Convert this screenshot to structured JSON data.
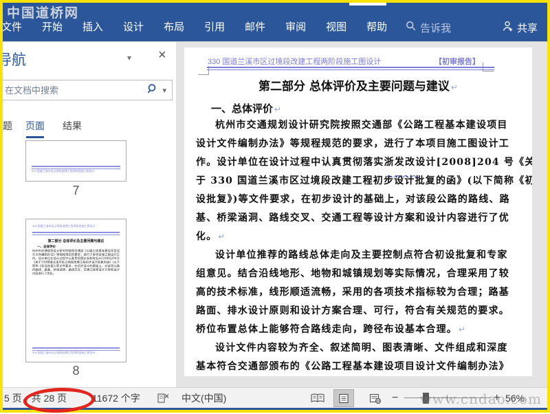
{
  "watermarks": {
    "top_left": "中国道桥网",
    "bottom_right": "www.cndao.com"
  },
  "ribbon": {
    "tabs": [
      "文件",
      "开始",
      "插入",
      "设计",
      "布局",
      "引用",
      "邮件",
      "审阅",
      "视图",
      "帮助"
    ],
    "tell_me": "告诉我",
    "share": "共享"
  },
  "navigation": {
    "title": "导航",
    "search_placeholder": "在文档中搜索",
    "tabs": [
      "标题",
      "页面",
      "结果"
    ],
    "active_tab": "页面",
    "thumbnails": [
      {
        "page": "7",
        "footer_text": "330 国道兰溪市区过境段改建工程两阶段施工图设计"
      },
      {
        "page": "8",
        "header_text": "330 国道兰溪市区过境段改建工程两阶段施工图设计",
        "preview_title": "第二部分 总体评价及主要问题与建议",
        "preview_heading": "一、总体评价",
        "preview_text": "杭州市交通规划设计研究院按照交通部《公路工程基本建设项目设计文件编制办法》等规程规范的要求，进行了本项目施工图设计工作。设计单位在设计过程中认真贯彻落实浙发改设计[2008]204号《关于330国道兰溪市区过境段改建工程初步设计批复的函》(以下简称《初设批复》)等文件要求，在初步设计的基础上，对该段公路的路线、路基、桥梁涵洞、路线交叉、交通工程等设计方案和设计内容进行了优化。",
        "footer_text": "330 国道兰溪市区过境段改建工程两阶段施工图设计"
      }
    ]
  },
  "document": {
    "header_left": "330 国道兰溪市区过境段改建工程两阶段施工图设计",
    "header_right": "【初审报告】",
    "title": "第二部分  总体评价及主要问题与建议",
    "heading": "一、总体评价",
    "paragraph_mark": "↵",
    "p1": [
      "杭州市交通规划设计研究院按照交通部《公路工程基本建设项目",
      "设计文件编制办法》等规程规范的要求，进行了本项目施工图设计工",
      "作。设计单位在设计过程中认真贯彻落实浙发改设计[2008]204 号《关",
      "于 330 国道兰溪市区过境段改建工程初步设计批复的函》(以下简称《初",
      "设批复》)等文件要求，在初步设计的基础上，对该段公路的路线、路",
      "基、桥梁涵洞、路线交叉、交通工程等设计方案和设计内容进行了优",
      "化。"
    ],
    "p2": [
      "设计单位推荐的路线总体走向及主要控制点符合初设批复和专家",
      "组意见。结合沿线地形、地物和城镇规划等实际情况，合理采用了较",
      "高的技术标准，线形顺适流畅，采用的各项技术指标较为合理；路基",
      "路面、排水设计原则和设计方案合理、可行，符合有关规范的要求。",
      "桥位布置总体上能够符合路线走向，跨径布设基本合理。"
    ],
    "p3": [
      "设计文件内容较为齐全、叙述简明、图表清晰、文件组成和深度",
      "基本符合交通部颁布的《公路工程基本建设项目设计文件编制办法》"
    ]
  },
  "status_bar": {
    "page_info": "5 页，共 28 页",
    "word_count": "11672 个字",
    "language": "中文(中国)",
    "zoom_level": "56%"
  },
  "colors": {
    "accent": "#2b579a",
    "annotation_red": "#e2251d",
    "header_blue": "#7b7bd9",
    "frame_yellow": "#f8e208"
  }
}
